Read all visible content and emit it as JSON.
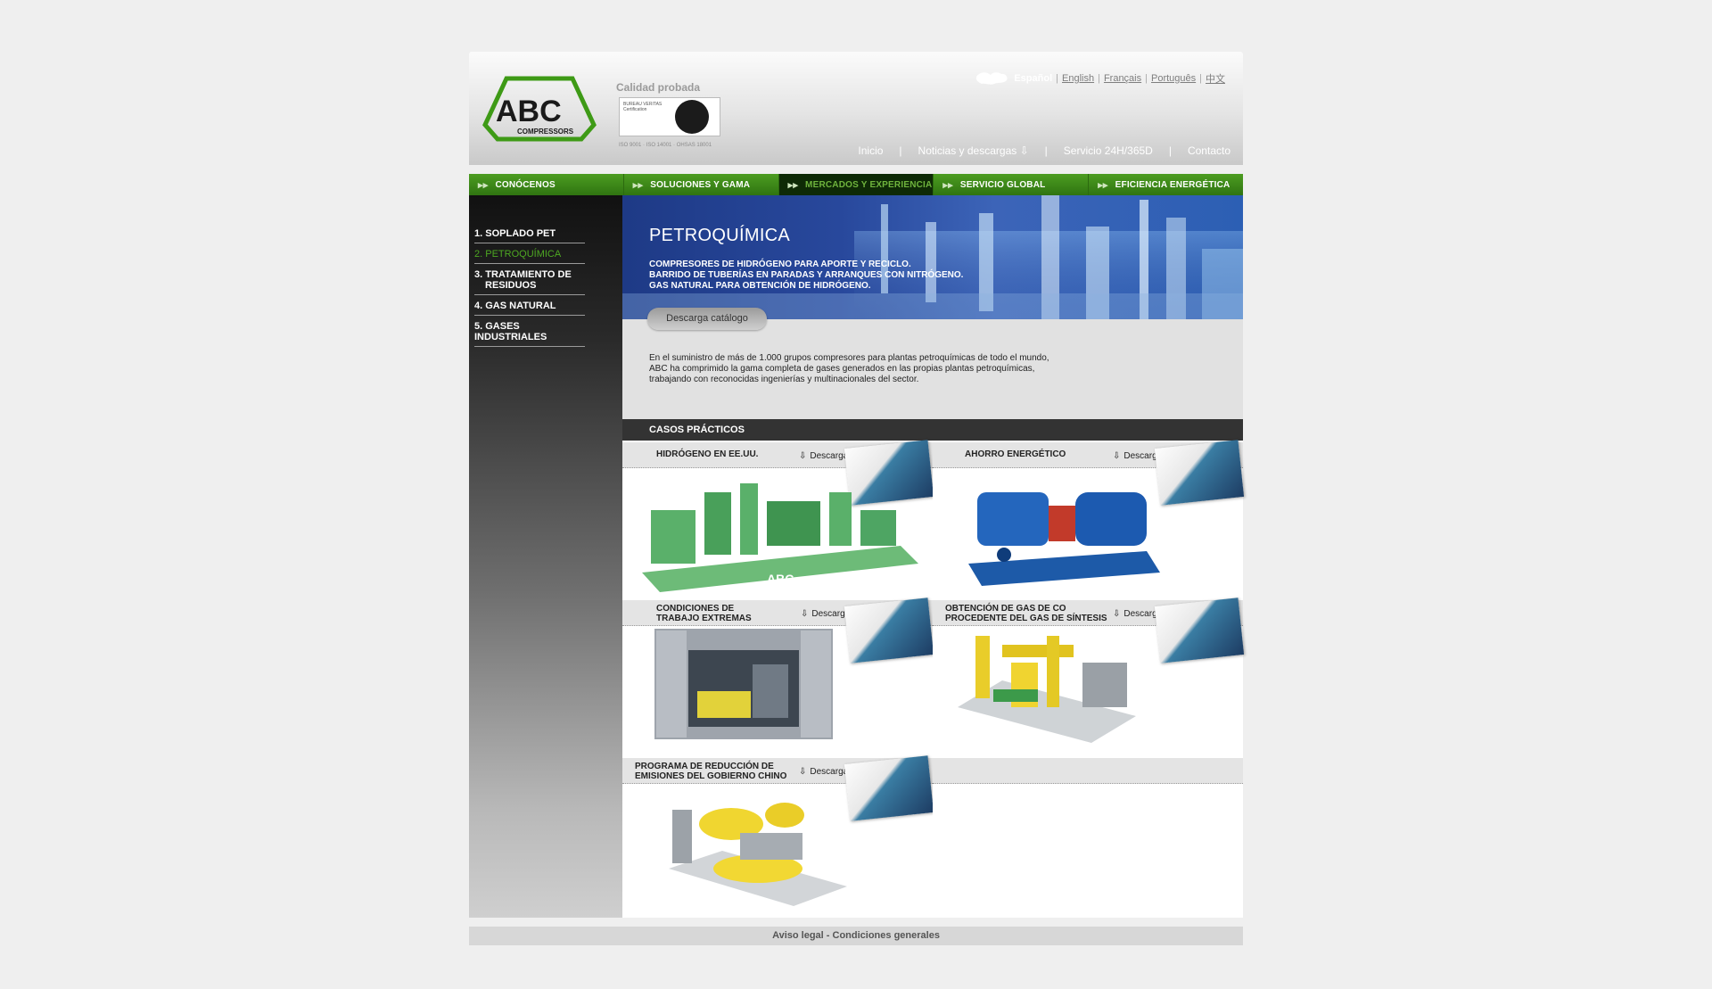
{
  "header": {
    "logo_text": "ABC",
    "logo_sub": "COMPRESSORS",
    "tagline": "Calidad probada",
    "cert_text": "BUREAU VERITAS Certification",
    "iso_text": "ISO 9001 · ISO 14001 · OHSAS 18001",
    "languages": [
      {
        "label": "Español",
        "active": true
      },
      {
        "label": "English",
        "active": false
      },
      {
        "label": "Français",
        "active": false
      },
      {
        "label": "Português",
        "active": false
      },
      {
        "label": "中文",
        "active": false
      }
    ],
    "topnav": [
      "Inicio",
      "Noticias y descargas",
      "Servicio 24H/365D",
      "Contacto"
    ]
  },
  "mainnav": [
    "CONÓCENOS",
    "SOLUCIONES Y GAMA",
    "MERCADOS Y EXPERIENCIA",
    "SERVICIO GLOBAL",
    "EFICIENCIA ENERGÉTICA"
  ],
  "sidebar": {
    "items": [
      {
        "num": "1.",
        "label": "SOPLADO PET"
      },
      {
        "num": "2.",
        "label": "PETROQUÍMICA"
      },
      {
        "num": "3.",
        "label": "TRATAMIENTO DE",
        "label2": "RESIDUOS"
      },
      {
        "num": "4.",
        "label": "GAS NATURAL"
      },
      {
        "num": "5.",
        "label": "GASES",
        "label2": "INDUSTRIALES"
      }
    ]
  },
  "banner": {
    "title": "PETROQUÍMICA",
    "lines": [
      "COMPRESORES DE HIDRÓGENO PARA APORTE Y RECICLO.",
      "BARRIDO DE TUBERÍAS EN PARADAS Y ARRANQUES CON NITRÓGENO.",
      "GAS NATURAL PARA OBTENCIÓN DE HIDRÓGENO."
    ]
  },
  "catalog_button": "Descarga catálogo",
  "intro": "En el suministro de más de 1.000 grupos compresores para plantas petroquímicas de todo el mundo, ABC ha comprimido la gama completa de gases generados en las propias plantas petroquímicas, trabajando con reconocidas ingenierías y multinacionales del sector.",
  "cases_title": "CASOS PRÁCTICOS",
  "download_label": "Descarga ficha.pdf",
  "cases": [
    {
      "title": "HIDRÓGENO EN EE.UU.",
      "title2": ""
    },
    {
      "title": "AHORRO ENERGÉTICO",
      "title2": ""
    },
    {
      "title": "CONDICIONES DE",
      "title2": "TRABAJO EXTREMAS"
    },
    {
      "title": "OBTENCIÓN DE GAS DE CO",
      "title2": "PROCEDENTE DEL GAS DE SÍNTESIS"
    },
    {
      "title": "PROGRAMA DE REDUCCIÓN DE",
      "title2": "EMISIONES DEL GOBIERNO CHINO"
    }
  ],
  "footer": "Aviso legal - Condiciones generales",
  "colors": {
    "brand_green": "#3f8d17",
    "active_green": "#4ea822",
    "banner_blue": "#28489c"
  }
}
